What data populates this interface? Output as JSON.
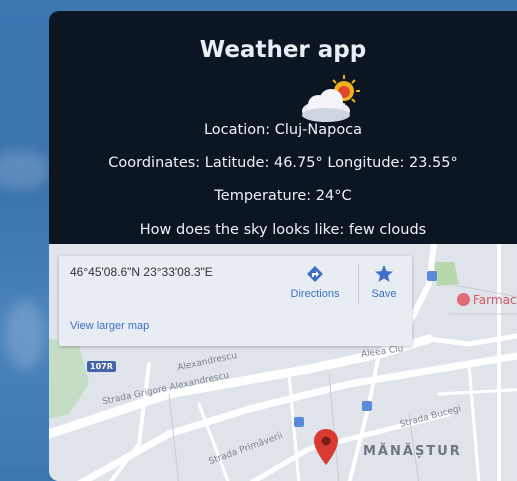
{
  "app": {
    "title": "Weather app",
    "location": "Location: Cluj-Napoca",
    "coordinates": "Coordinates: Latitude: 46.75° Longitude: 23.55°",
    "temperature": "Temperature: 24°C",
    "sky": "How does the sky looks like: few clouds",
    "weather_icon": "few-clouds-icon"
  },
  "map": {
    "coords": "46°45'08.6\"N 23°33'08.3\"E",
    "directions_label": "Directions",
    "save_label": "Save",
    "larger_map_label": "View larger map",
    "streets": {
      "grigore": "Strada Grigore Alexandrescu",
      "alexandrescu": "Alexandrescu",
      "aleea": "Aleea Clu",
      "primaverii": "Strada Primăverii",
      "bucegi": "Strada Bucegi"
    },
    "road_number": "107R",
    "district": "MĂNĂȘTUR",
    "pharmacy": "Farmac",
    "accent_color": "#3d6fc7",
    "pin_color": "#d93b33"
  }
}
